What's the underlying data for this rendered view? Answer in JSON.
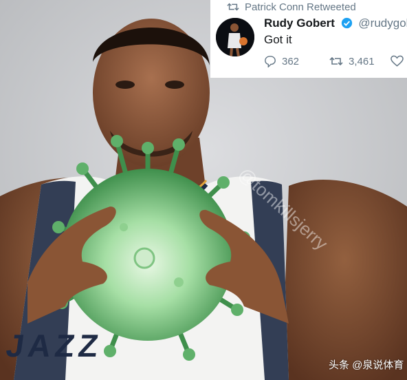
{
  "tweet": {
    "retweet_text": "Patrick Conn Retweeted",
    "name": "Rudy Gobert",
    "handle": "@rudygobert",
    "text": "Got it",
    "replies": "362",
    "retweets": "3,461"
  },
  "watermark": "头条 @泉说体育",
  "photo_overlay_text": "@tomkillsjerry",
  "jersey_text": "JAZZ",
  "colors": {
    "virus_green": "#7fd08a",
    "jersey_navy": "#1e2a44",
    "jersey_gold": "#e0a23a",
    "verified_blue": "#1da1f2"
  },
  "icons": [
    "retweet-icon",
    "verified-icon",
    "reply-icon",
    "like-icon"
  ]
}
